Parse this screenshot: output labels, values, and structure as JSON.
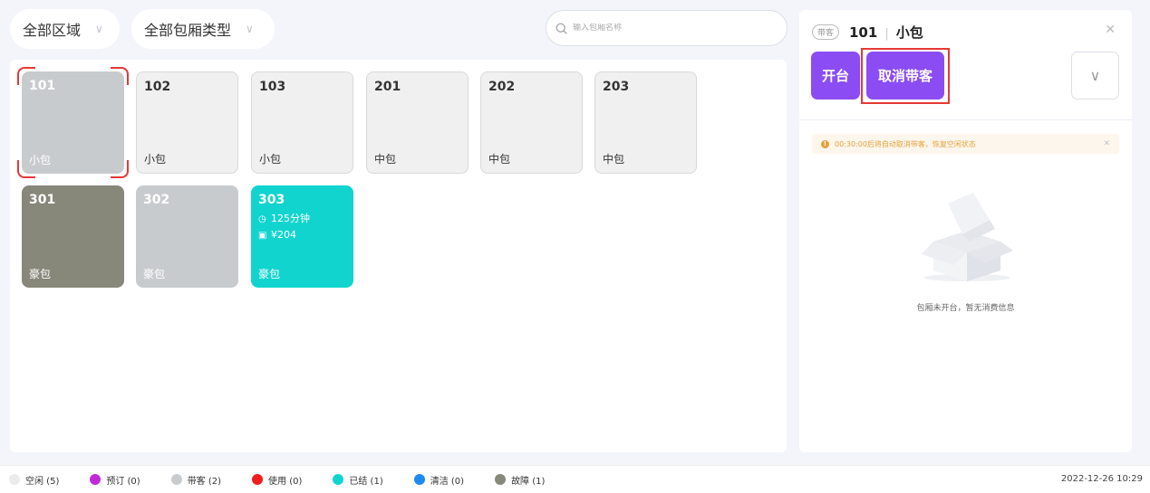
{
  "filters": {
    "area": "全部区域",
    "room_type": "全部包厢类型"
  },
  "search": {
    "placeholder": "输入包厢名称"
  },
  "rooms": [
    {
      "number": "101",
      "type": "小包",
      "status": "带客"
    },
    {
      "number": "102",
      "type": "小包",
      "status": "空闲"
    },
    {
      "number": "103",
      "type": "小包",
      "status": "空闲"
    },
    {
      "number": "201",
      "type": "中包",
      "status": "空闲"
    },
    {
      "number": "202",
      "type": "中包",
      "status": "空闲"
    },
    {
      "number": "203",
      "type": "中包",
      "status": "空闲"
    },
    {
      "number": "301",
      "type": "豪包",
      "status": "故障"
    },
    {
      "number": "302",
      "type": "豪包",
      "status": "带客"
    },
    {
      "number": "303",
      "type": "豪包",
      "status": "已结",
      "duration": "125分钟",
      "amount": "¥204"
    }
  ],
  "detail": {
    "tag": "带客",
    "room_number": "101",
    "separator": "|",
    "room_type": "小包",
    "open_button": "开台",
    "cancel_button": "取消带客",
    "notice": "00:30:00后将自动取消带客，恢复空闲状态",
    "empty_text": "包厢未开台，暂无消费信息"
  },
  "legend": [
    {
      "label": "空闲 (5)",
      "color": "#ebebeb"
    },
    {
      "label": "预订 (0)",
      "color": "#c22ad8"
    },
    {
      "label": "带客 (2)",
      "color": "#c8cbcd"
    },
    {
      "label": "使用 (0)",
      "color": "#ef1d1d"
    },
    {
      "label": "已结 (1)",
      "color": "#12d4cf"
    },
    {
      "label": "清洁 (0)",
      "color": "#1e8af0"
    },
    {
      "label": "故障 (1)",
      "color": "#87877a"
    }
  ],
  "clock": "2022-12-26 10:29",
  "icons": {
    "search": "search-icon",
    "chevron": "chevron-down-icon",
    "close": "close-icon",
    "clock": "clock-icon",
    "money": "money-icon",
    "warning": "warning-icon"
  }
}
